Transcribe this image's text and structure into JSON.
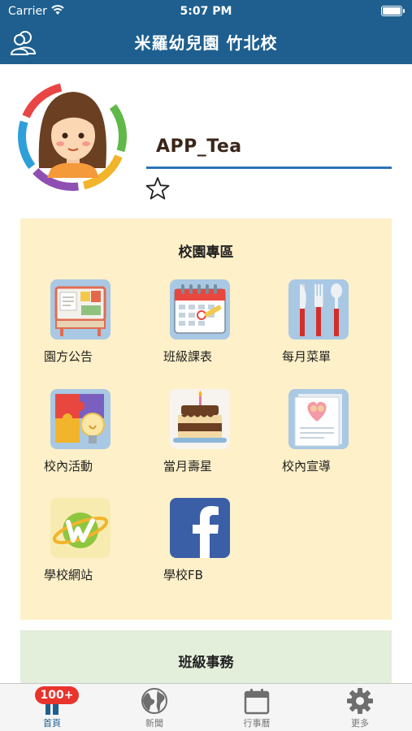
{
  "status_bar": {
    "carrier": "Carrier",
    "time": "5:07 PM"
  },
  "header": {
    "title": "米羅幼兒園 竹北校",
    "left_icon": "contacts-icon"
  },
  "profile": {
    "username": "APP_Tea",
    "favorite_icon": "star-icon"
  },
  "campus": {
    "title": "校園專區",
    "items": [
      {
        "label": "園方公告",
        "icon": "bulletin-board-icon"
      },
      {
        "label": "班級課表",
        "icon": "calendar-icon"
      },
      {
        "label": "每月菜單",
        "icon": "cutlery-icon"
      },
      {
        "label": "校內活動",
        "icon": "puzzle-icon"
      },
      {
        "label": "當月壽星",
        "icon": "birthday-cake-icon"
      },
      {
        "label": "校內宣導",
        "icon": "newsletter-icon"
      },
      {
        "label": "學校網站",
        "icon": "website-icon"
      },
      {
        "label": "學校FB",
        "icon": "facebook-icon"
      }
    ]
  },
  "class_section": {
    "title": "班級事務"
  },
  "tabbar": {
    "badge": "100+",
    "tabs": [
      {
        "label": "首頁",
        "icon": "home-icon",
        "active": true
      },
      {
        "label": "新聞",
        "icon": "globe-icon",
        "active": false
      },
      {
        "label": "行事曆",
        "icon": "calendar-icon",
        "active": false
      },
      {
        "label": "更多",
        "icon": "gear-icon",
        "active": false
      }
    ]
  },
  "colors": {
    "header": "#1e5f8f",
    "campus_bg": "#fef0c8",
    "class_bg": "#e3eedb",
    "badge": "#e8342c",
    "underline": "#2b72b8"
  }
}
